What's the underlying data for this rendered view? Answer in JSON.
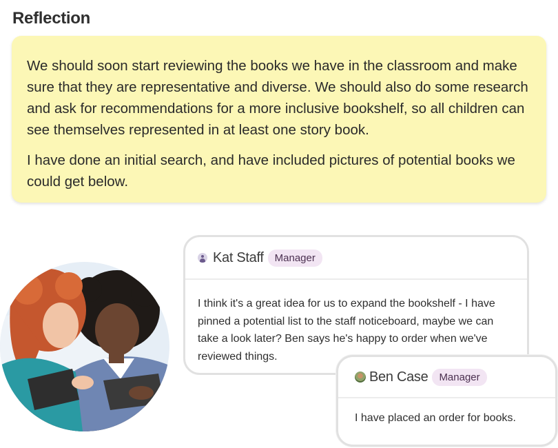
{
  "section": {
    "title": "Reflection"
  },
  "reflection": {
    "paragraphs": [
      "We should soon start reviewing the books we have in the classroom and make sure that they are representative and diverse. We should also do some research and ask for recommendations for a more inclusive bookshelf, so all children can see themselves represented in at least one story book.",
      "I have done an initial search, and have included pictures of potential books we could get below."
    ],
    "background_color": "#fcf7b6"
  },
  "comments": [
    {
      "author": "Kat Staff",
      "role": "Manager",
      "avatar_icon": "user-icon",
      "text": "I think it's a great idea for us to expand the bookshelf - I have pinned a potential list to the staff noticeboard, maybe we can take a look later? Ben says he's happy to order when we've reviewed things."
    },
    {
      "author": "Ben Case",
      "role": "Manager",
      "avatar_icon": "profile-photo",
      "text": "I have placed an order for books."
    }
  ],
  "colors": {
    "badge_bg": "#f2e5f3",
    "badge_text": "#4b3050",
    "card_border": "#e1e1e1"
  }
}
